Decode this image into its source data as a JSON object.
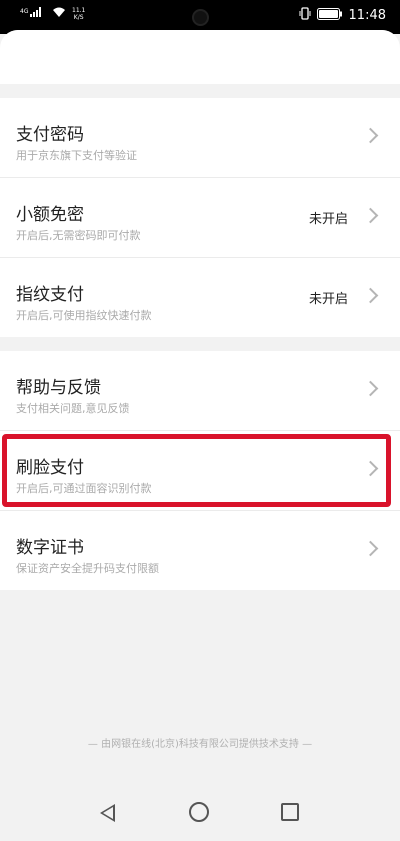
{
  "status_bar": {
    "signal_label": "4G",
    "net_speed_top": "11.1",
    "net_speed_bottom": "K/S",
    "time": "11:48"
  },
  "section_one": [
    {
      "title": "支付密码",
      "subtitle": "用于京东旗下支付等验证",
      "value": ""
    },
    {
      "title": "小额免密",
      "subtitle": "开启后,无需密码即可付款",
      "value": "未开启"
    },
    {
      "title": "指纹支付",
      "subtitle": "开启后,可使用指纹快速付款",
      "value": "未开启"
    }
  ],
  "section_two": [
    {
      "title": "帮助与反馈",
      "subtitle": "支付相关问题,意见反馈",
      "value": ""
    },
    {
      "title": "刷脸支付",
      "subtitle": "开启后,可通过面容识别付款",
      "value": "",
      "highlighted": true
    },
    {
      "title": "数字证书",
      "subtitle": "保证资产安全提升码支付限额",
      "value": ""
    }
  ],
  "footer": "— 由网银在线(北京)科技有限公司提供技术支持 —",
  "colors": {
    "highlight": "#d9132b",
    "background": "#f2f2f2"
  }
}
